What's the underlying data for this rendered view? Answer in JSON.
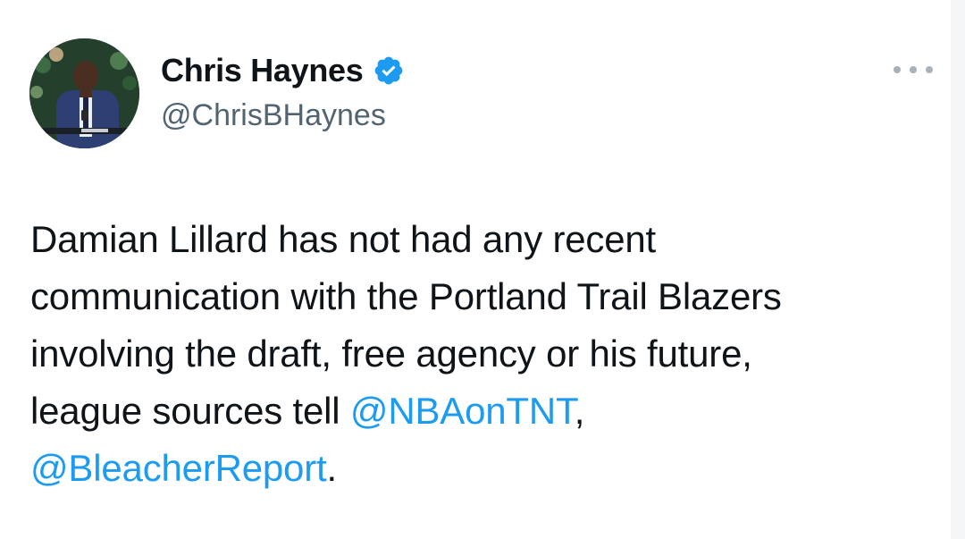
{
  "author": {
    "display_name": "Chris Haynes",
    "handle": "@ChrisBHaynes",
    "verified": true,
    "avatar_icon": "avatar-photo"
  },
  "tweet": {
    "line1": "Damian Lillard has not had any recent",
    "line2": "communication with the Portland Trail Blazers",
    "line3": "involving the draft, free agency or his future,",
    "line4_text": "league sources tell ",
    "mention1": "@NBAonTNT",
    "after_mention1": ",",
    "mention2": "@BleacherReport",
    "after_mention2": "."
  },
  "icons": {
    "verified": "verified-badge-icon",
    "more": "more-options-icon"
  },
  "colors": {
    "link": "#1d9bf0",
    "text": "#0f1419",
    "secondary": "#536471",
    "verified": "#1d9bf0"
  }
}
